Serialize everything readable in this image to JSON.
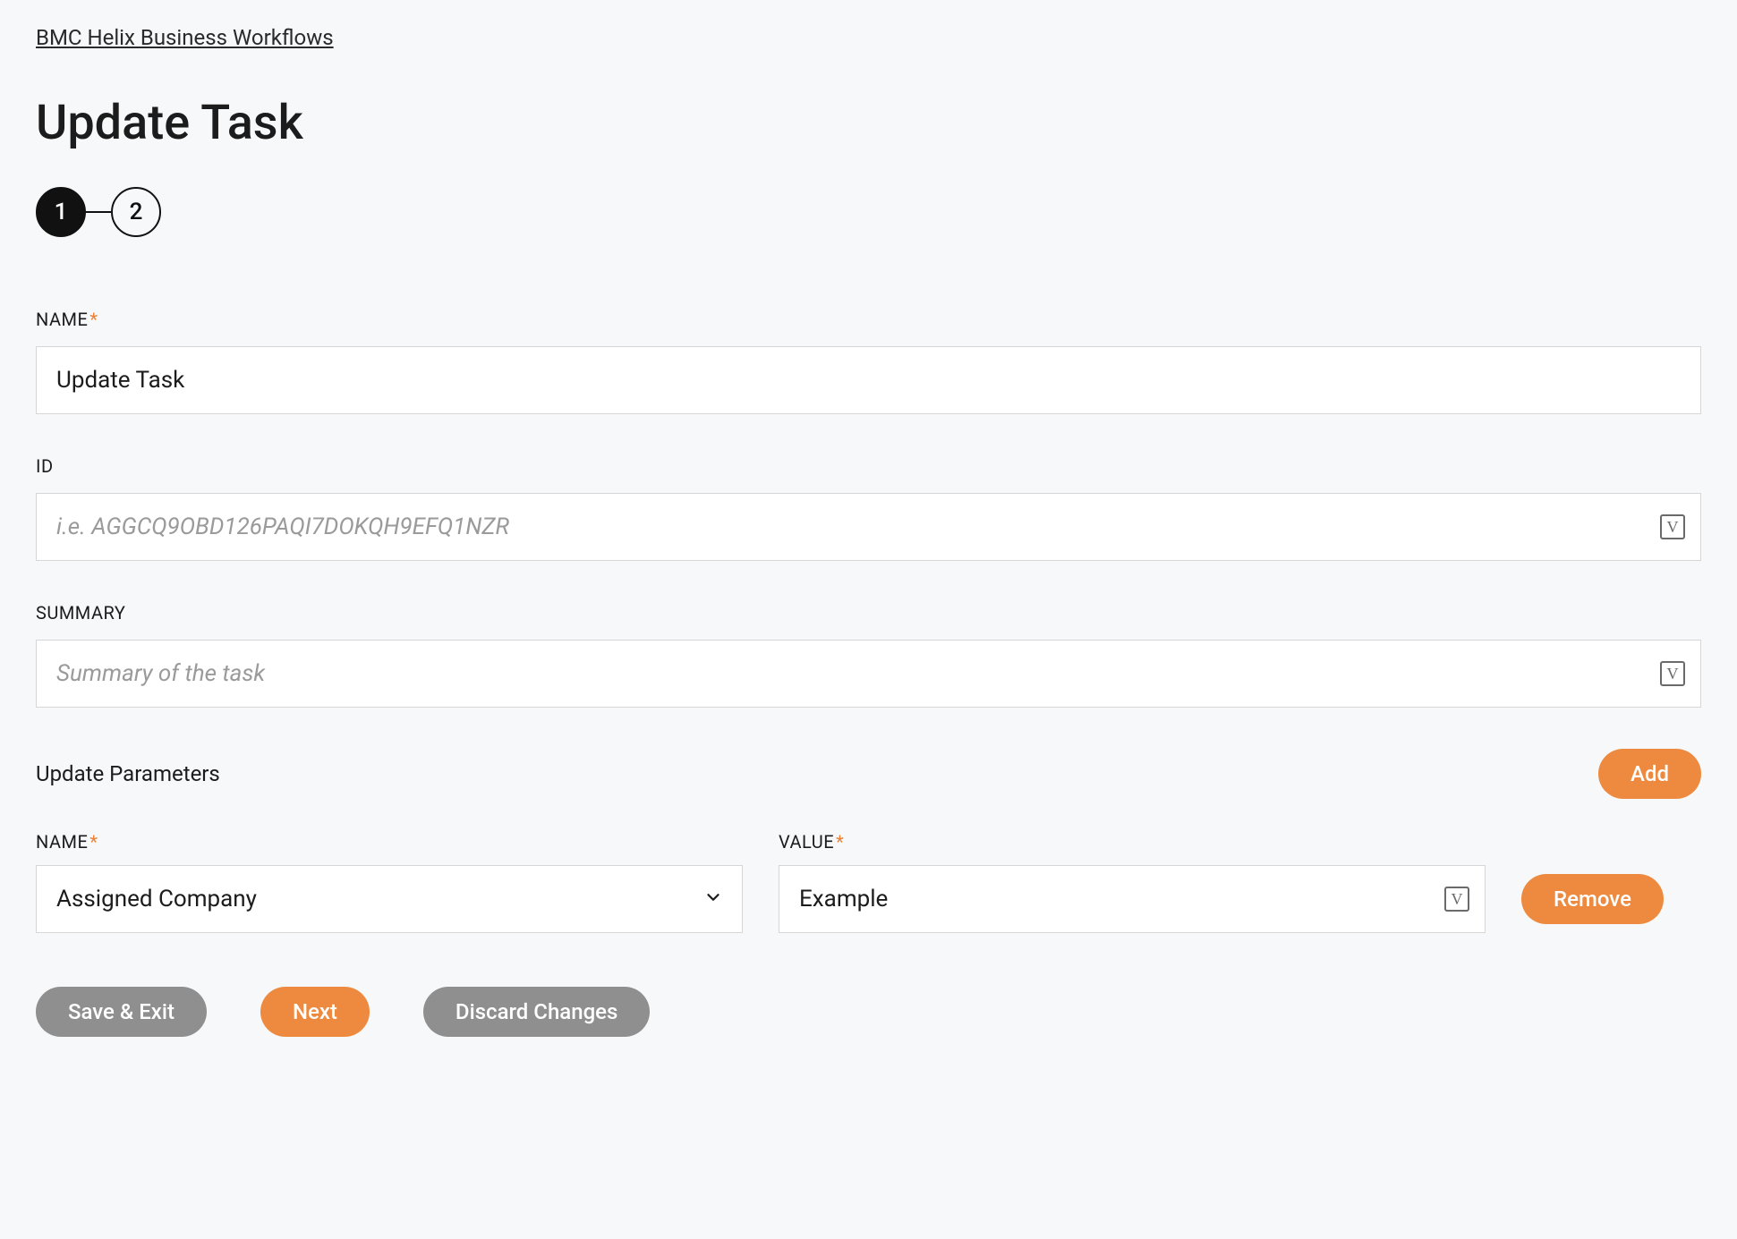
{
  "breadcrumb": {
    "label": "BMC Helix Business Workflows"
  },
  "page": {
    "title": "Update Task"
  },
  "stepper": {
    "steps": [
      "1",
      "2"
    ],
    "activeIndex": 0
  },
  "fields": {
    "name": {
      "label": "NAME",
      "required": true,
      "value": "Update Task"
    },
    "id": {
      "label": "ID",
      "required": false,
      "value": "",
      "placeholder": "i.e. AGGCQ9OBD126PAQI7DOKQH9EFQ1NZR"
    },
    "summary": {
      "label": "SUMMARY",
      "required": false,
      "value": "",
      "placeholder": "Summary of the task"
    }
  },
  "parameters": {
    "section_label": "Update Parameters",
    "add_label": "Add",
    "remove_label": "Remove",
    "name_label": "NAME",
    "value_label": "VALUE",
    "rows": [
      {
        "name": "Assigned Company",
        "value": "Example"
      }
    ]
  },
  "footer": {
    "save_exit": "Save & Exit",
    "next": "Next",
    "discard": "Discard Changes"
  },
  "icons": {
    "variable_glyph": "V"
  }
}
